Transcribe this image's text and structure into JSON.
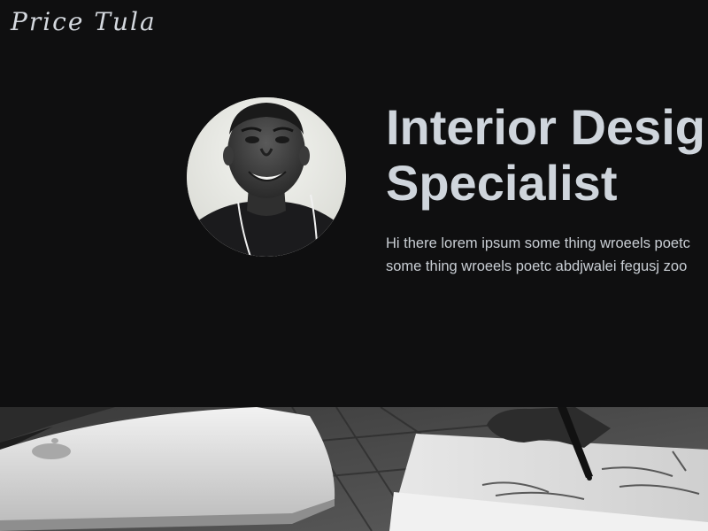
{
  "header": {
    "logo_text": "Price Tula"
  },
  "hero": {
    "avatar_alt": "profile-photo",
    "headline_line1": "Interior Design",
    "headline_line2": "Specialist",
    "intro_line1": "Hi there lorem ipsum some thing wroeels poetc",
    "intro_line2": "some thing wroeels poetc abdjwalei fegusj zoo"
  },
  "colors": {
    "page_background": "#0f0f10",
    "headline": "#cfd5dc",
    "body_text": "#c9ced4"
  }
}
